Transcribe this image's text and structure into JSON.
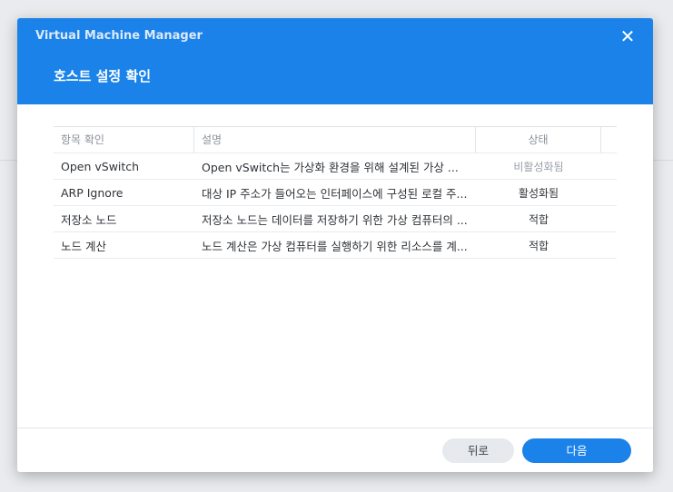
{
  "window": {
    "app_title": "Virtual Machine Manager",
    "page_title": "호스트 설정 확인",
    "close_symbol": "✕"
  },
  "table": {
    "headers": [
      "항목 확인",
      "설명",
      "상태"
    ],
    "rows": [
      {
        "item": "Open vSwitch",
        "desc": "Open vSwitch는 가상화 환경을 위해 설계된 가상 ...",
        "status": "비활성화됨"
      },
      {
        "item": "ARP Ignore",
        "desc": "대상 IP 주소가 들어오는 인터페이스에 구성된 로컬 주...",
        "status": "활성화됨"
      },
      {
        "item": "저장소 노드",
        "desc": "저장소 노드는 데이터를 저장하기 위한 가상 컴퓨터의 ...",
        "status": "적합"
      },
      {
        "item": "노드 계산",
        "desc": "노드 계산은 가상 컴퓨터를 실행하기 위한 리소스를 계...",
        "status": "적합"
      }
    ]
  },
  "footer": {
    "back_label": "뒤로",
    "next_label": "다음"
  },
  "colors": {
    "accent": "#1a82e8"
  },
  "icons": {
    "close": "close-icon"
  }
}
